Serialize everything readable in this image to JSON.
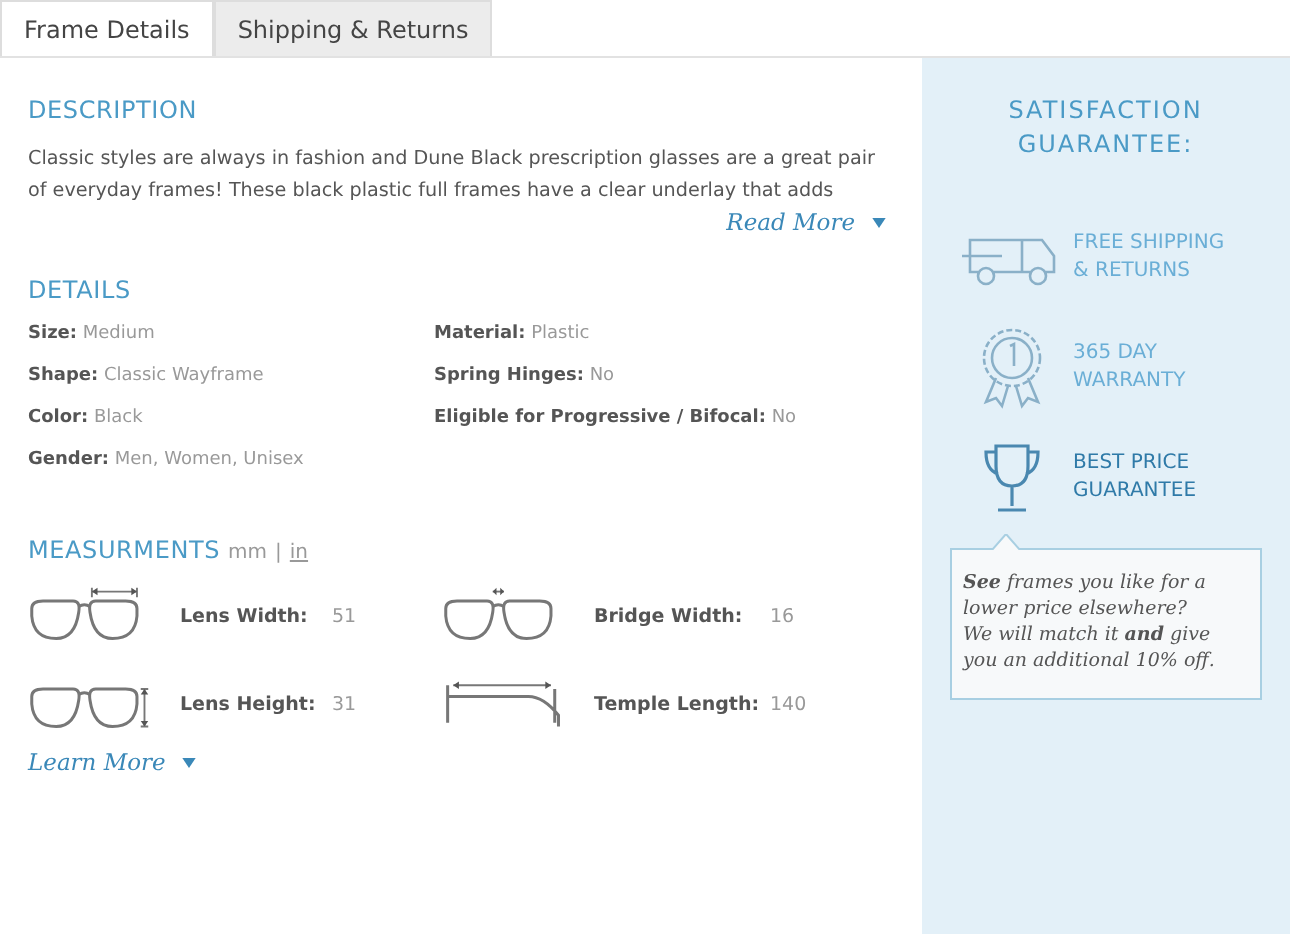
{
  "tabs": [
    {
      "label": "Frame Details",
      "selected": true
    },
    {
      "label": "Shipping & Returns",
      "selected": false
    }
  ],
  "description": {
    "heading": "DESCRIPTION",
    "text": "Classic styles are always in fashion and Dune Black prescription glasses are a great pair of everyday frames! These black plastic full frames have a clear underlay that adds",
    "read_more": "Read More"
  },
  "details": {
    "heading": "DETAILS",
    "left": [
      {
        "label": "Size:",
        "value": "Medium"
      },
      {
        "label": "Shape:",
        "value": "Classic Wayframe"
      },
      {
        "label": "Color:",
        "value": "Black"
      },
      {
        "label": "Gender:",
        "value": "Men, Women, Unisex"
      }
    ],
    "right": [
      {
        "label": "Material:",
        "value": "Plastic"
      },
      {
        "label": "Spring Hinges:",
        "value": "No"
      },
      {
        "label": "Eligible for Progressive / Bifocal:",
        "value": "No"
      }
    ]
  },
  "measurements": {
    "heading": "MEASURMENTS",
    "units": [
      {
        "label": "mm",
        "selected": true
      },
      {
        "label": "in",
        "selected": false
      }
    ],
    "separator": "|",
    "items": [
      {
        "kind": "lens-width",
        "label": "Lens Width:",
        "value": "51"
      },
      {
        "kind": "bridge-width",
        "label": "Bridge Width:",
        "value": "16"
      },
      {
        "kind": "lens-height",
        "label": "Lens Height:",
        "value": "31"
      },
      {
        "kind": "temple-length",
        "label": "Temple Length:",
        "value": "140"
      }
    ],
    "learn_more": "Learn More"
  },
  "guarantee": {
    "heading": "SATISFACTION GUARANTEE:",
    "benefits": [
      {
        "kind": "truck",
        "title": "FREE SHIPPING & RETURNS",
        "selected": false
      },
      {
        "kind": "badge",
        "title": "365 DAY WARRANTY",
        "selected": false
      },
      {
        "kind": "trophy",
        "title": "BEST PRICE GUARANTEE",
        "selected": true
      }
    ],
    "tooltip": [
      "**See** frames you like for a lower price elsewhere?",
      "We will match it **and** give you an additional 10% off."
    ]
  }
}
